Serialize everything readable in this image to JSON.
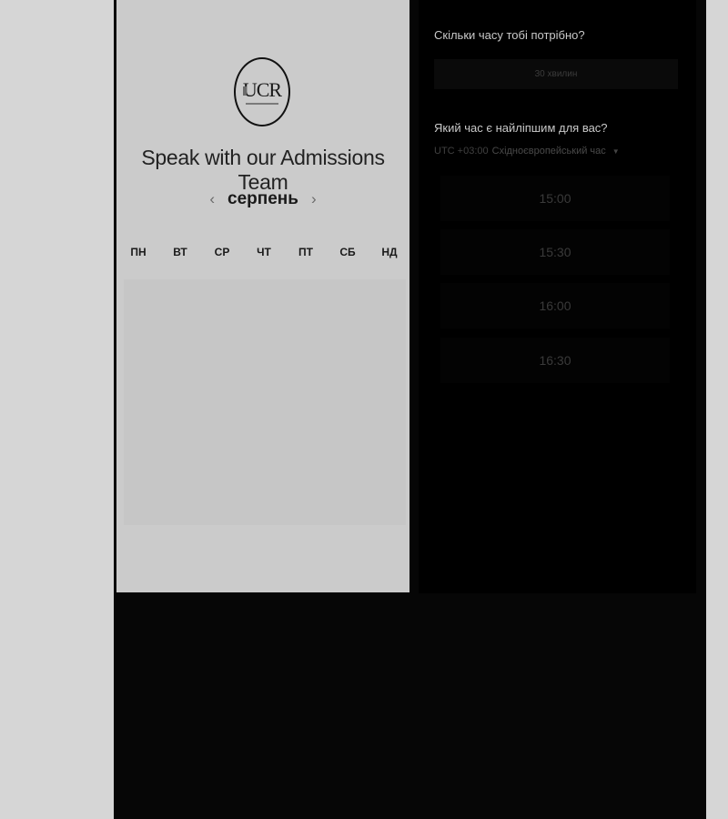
{
  "scheduler": {
    "logo_text": "UCR",
    "title": "Speak with our Admissions Team",
    "month": "серпень",
    "prev_icon": "chevron-left-icon",
    "next_icon": "chevron-right-icon",
    "weekdays": [
      "ПН",
      "ВТ",
      "СР",
      "ЧТ",
      "ПТ",
      "СБ",
      "НД"
    ]
  },
  "booking": {
    "duration_question": "Скільки часу тобі потрібно?",
    "duration_value": "30 хвилин",
    "time_question": "Який час є найліпшим для вас?",
    "timezone_offset": "UTC +03:00",
    "timezone_name": "Східноєвропейський час",
    "slots": [
      "15:00",
      "15:30",
      "16:00",
      "16:30"
    ]
  },
  "colors": {
    "page_bg": "#d6d6d6",
    "panel_bg": "#cbcbcb",
    "dark_bg": "#000000"
  }
}
